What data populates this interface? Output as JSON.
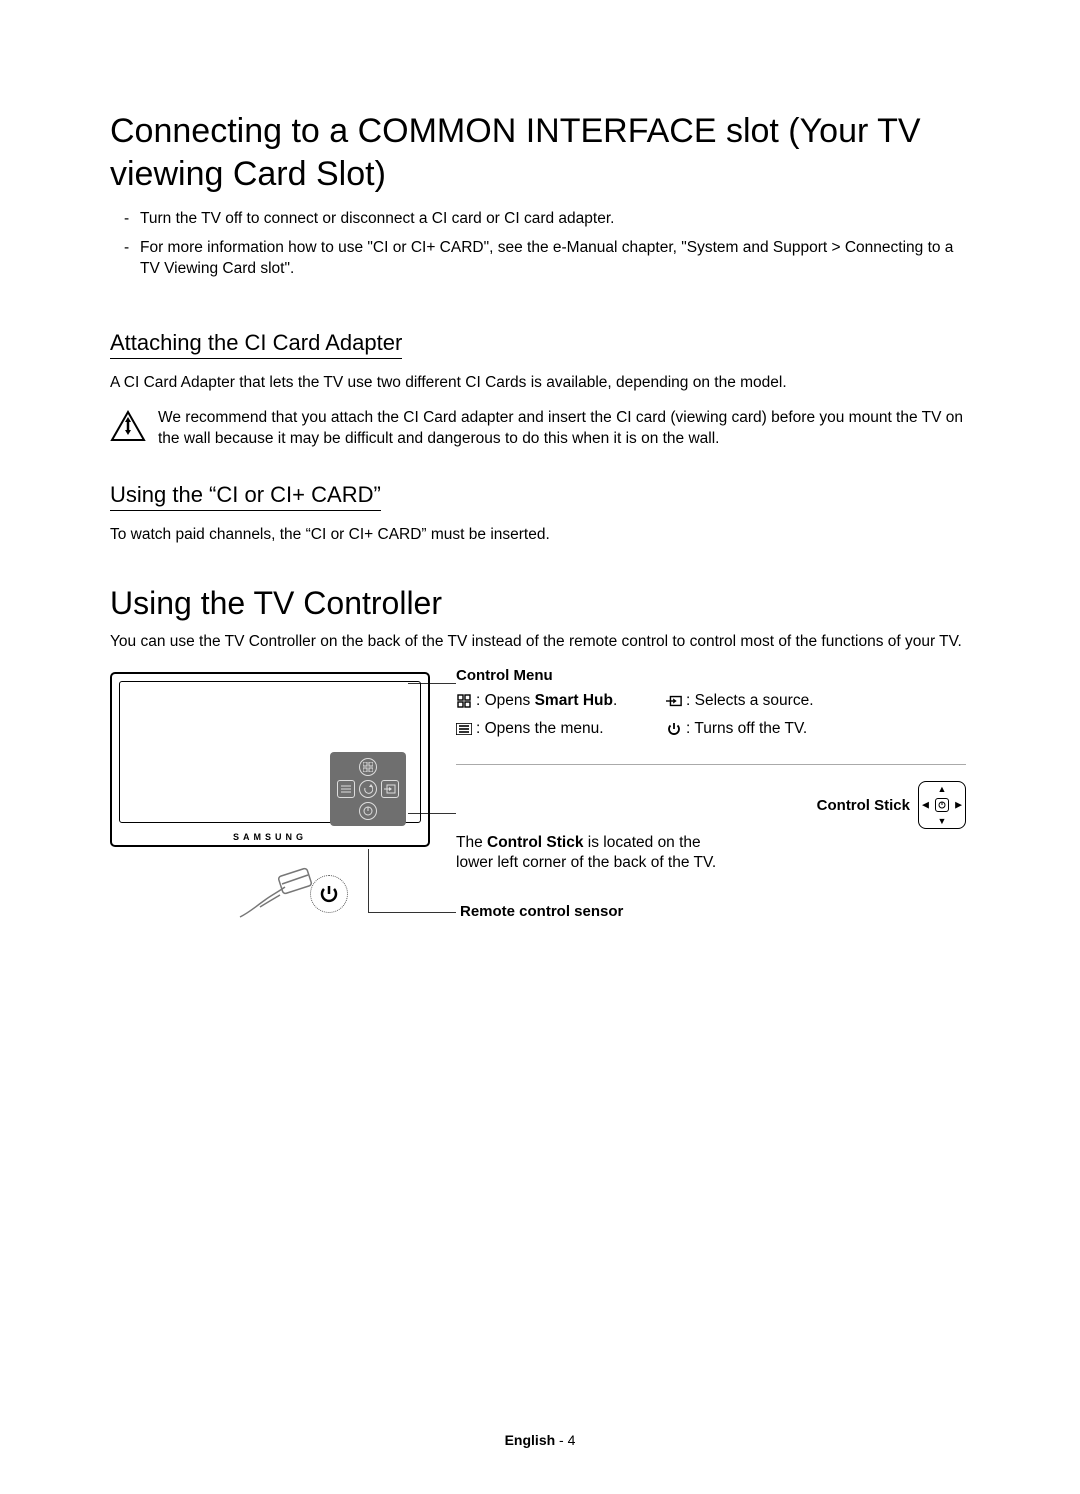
{
  "section1": {
    "heading": "Connecting to a COMMON INTERFACE slot (Your TV viewing Card Slot)",
    "bullets": [
      "Turn the TV off to connect or disconnect a CI card or CI card adapter.",
      "For more information how to use \"CI or CI+ CARD\", see the e-Manual chapter, \"System and Support > Connecting to a TV Viewing Card slot\"."
    ],
    "sub1": {
      "heading": "Attaching the CI Card Adapter",
      "text": "A CI Card Adapter that lets the TV use two different CI Cards is available, depending on the model.",
      "warning": "We recommend that you attach the CI Card adapter and insert the CI card (viewing card) before you mount the TV on the wall because it may be difficult and dangerous to do this when it is on the wall."
    },
    "sub2": {
      "heading": "Using the “CI or CI+ CARD”",
      "text": "To watch paid channels, the “CI or CI+ CARD” must be inserted."
    }
  },
  "section2": {
    "heading": "Using the TV Controller",
    "intro": "You can use the TV Controller on the back of the TV instead of the remote control to control most of the functions of your TV.",
    "tv_brand": "SAMSUNG",
    "control_menu": {
      "title": "Control Menu",
      "items": [
        {
          "pre": ": Opens ",
          "bold": "Smart Hub",
          "post": "."
        },
        {
          "pre": ": Selects a source.",
          "bold": "",
          "post": ""
        },
        {
          "pre": ": Opens the menu.",
          "bold": "",
          "post": ""
        },
        {
          "pre": ": Turns off the TV.",
          "bold": "",
          "post": ""
        }
      ]
    },
    "control_stick": {
      "title": "Control Stick",
      "line1_pre": "The ",
      "line1_bold": "Control Stick",
      "line1_post": " is located on the",
      "line2": "lower left corner of the back of the TV."
    },
    "sensor_label": "Remote control sensor"
  },
  "footer": {
    "lang": "English",
    "sep": " - ",
    "page": "4"
  }
}
